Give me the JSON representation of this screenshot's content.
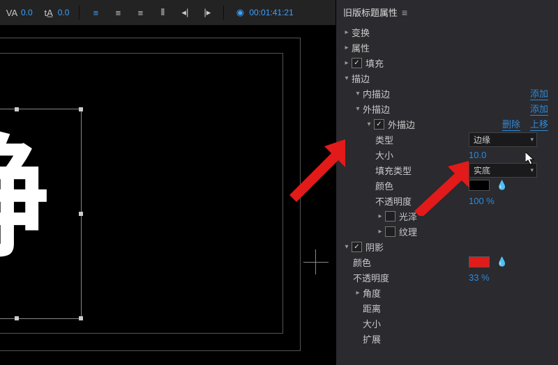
{
  "toolbar": {
    "va_value": "0.0",
    "ta_value": "0.0",
    "timecode": "00:01:41:21"
  },
  "canvas": {
    "text": "静"
  },
  "panel": {
    "title": "旧版标题属性",
    "sections": {
      "transform": "变换",
      "attributes": "属性",
      "fill": "填充",
      "stroke": "描边"
    },
    "stroke": {
      "inner": {
        "label": "内描边",
        "add": "添加"
      },
      "outer": {
        "label": "外描边",
        "add": "添加"
      },
      "outer_item": {
        "label": "外描边",
        "delete": "删除",
        "move_up": "上移",
        "type_label": "类型",
        "type_value": "边缘",
        "size_label": "大小",
        "size_value": "10.0",
        "fill_type_label": "填充类型",
        "fill_type_value": "实底",
        "color_label": "颜色",
        "color_value": "#000000",
        "opacity_label": "不透明度",
        "opacity_value": "100 %",
        "sheen_label": "光泽",
        "texture_label": "纹理"
      }
    },
    "shadow": {
      "label": "阴影",
      "color_label": "颜色",
      "color_value": "#e21a1a",
      "opacity_label": "不透明度",
      "opacity_value": "33 %",
      "angle_label": "角度",
      "distance_label": "距离",
      "size_label": "大小",
      "spread_label": "扩展"
    }
  }
}
